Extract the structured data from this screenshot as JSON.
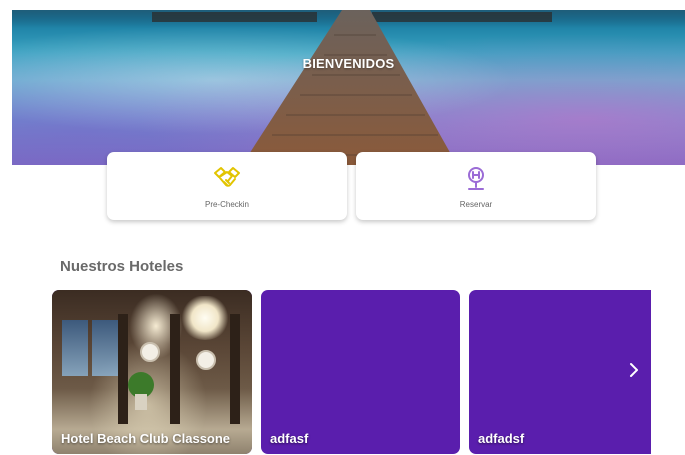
{
  "hero": {
    "title": "BIENVENIDOS"
  },
  "actions": [
    {
      "label": "Pre-Checkin",
      "icon": "handshake-icon",
      "color": "#e2c400"
    },
    {
      "label": "Reservar",
      "icon": "hotel-location-icon",
      "color": "#9b6cd6"
    }
  ],
  "section": {
    "title": "Nuestros Hoteles"
  },
  "hotels": [
    {
      "name": "Hotel Beach Club Classone"
    },
    {
      "name": "adfasf"
    },
    {
      "name": "adfadsf"
    }
  ],
  "carousel": {
    "next_icon": "chevron-right-icon"
  },
  "colors": {
    "accent_purple": "#5a1ead",
    "card_bg": "#ffffff",
    "section_text": "#6a6a6a"
  }
}
